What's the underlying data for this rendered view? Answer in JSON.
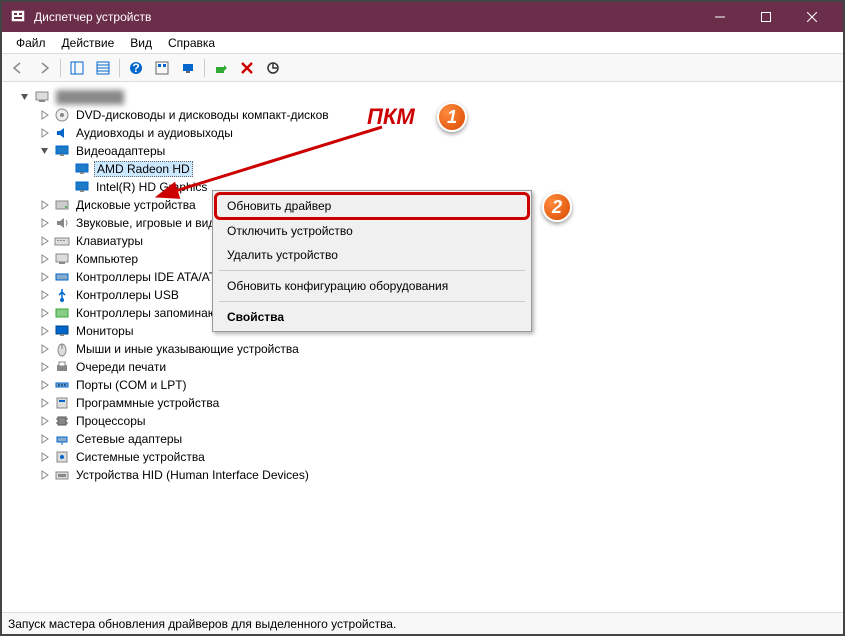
{
  "title": "Диспетчер устройств",
  "menubar": [
    "Файл",
    "Действие",
    "Вид",
    "Справка"
  ],
  "root_pc": "████████",
  "tree": [
    {
      "indent": 1,
      "expander": "closed",
      "icon": "disc",
      "label": "DVD-дисководы и дисководы компакт-дисков"
    },
    {
      "indent": 1,
      "expander": "closed",
      "icon": "audio",
      "label": "Аудиовходы и аудиовыходы"
    },
    {
      "indent": 1,
      "expander": "open",
      "icon": "display",
      "label": "Видеоадаптеры"
    },
    {
      "indent": 2,
      "expander": "none",
      "icon": "display",
      "label": "AMD Radeon HD",
      "selected": true
    },
    {
      "indent": 2,
      "expander": "none",
      "icon": "display",
      "label": "Intel(R) HD Graphics"
    },
    {
      "indent": 1,
      "expander": "closed",
      "icon": "disk",
      "label": "Дисковые устройства"
    },
    {
      "indent": 1,
      "expander": "closed",
      "icon": "sound",
      "label": "Звуковые, игровые и видеоустройства"
    },
    {
      "indent": 1,
      "expander": "closed",
      "icon": "keyboard",
      "label": "Клавиатуры"
    },
    {
      "indent": 1,
      "expander": "closed",
      "icon": "computer",
      "label": "Компьютер"
    },
    {
      "indent": 1,
      "expander": "closed",
      "icon": "ide",
      "label": "Контроллеры IDE ATA/ATAPI"
    },
    {
      "indent": 1,
      "expander": "closed",
      "icon": "usb",
      "label": "Контроллеры USB"
    },
    {
      "indent": 1,
      "expander": "closed",
      "icon": "storage",
      "label": "Контроллеры запоминающих устройств"
    },
    {
      "indent": 1,
      "expander": "closed",
      "icon": "monitor",
      "label": "Мониторы"
    },
    {
      "indent": 1,
      "expander": "closed",
      "icon": "mouse",
      "label": "Мыши и иные указывающие устройства"
    },
    {
      "indent": 1,
      "expander": "closed",
      "icon": "printer",
      "label": "Очереди печати"
    },
    {
      "indent": 1,
      "expander": "closed",
      "icon": "port",
      "label": "Порты (COM и LPT)"
    },
    {
      "indent": 1,
      "expander": "closed",
      "icon": "software",
      "label": "Программные устройства"
    },
    {
      "indent": 1,
      "expander": "closed",
      "icon": "cpu",
      "label": "Процессоры"
    },
    {
      "indent": 1,
      "expander": "closed",
      "icon": "network",
      "label": "Сетевые адаптеры"
    },
    {
      "indent": 1,
      "expander": "closed",
      "icon": "system",
      "label": "Системные устройства"
    },
    {
      "indent": 1,
      "expander": "closed",
      "icon": "hid",
      "label": "Устройства HID (Human Interface Devices)"
    }
  ],
  "context_menu": {
    "items": [
      {
        "label": "Обновить драйвер",
        "highlight": true
      },
      {
        "label": "Отключить устройство"
      },
      {
        "label": "Удалить устройство"
      },
      {
        "sep": true
      },
      {
        "label": "Обновить конфигурацию оборудования"
      },
      {
        "sep": true
      },
      {
        "label": "Свойства",
        "bold": true
      }
    ]
  },
  "annotations": {
    "pkm": "ПКМ",
    "badge1": "1",
    "badge2": "2"
  },
  "statusbar": "Запуск мастера обновления драйверов для выделенного устройства."
}
